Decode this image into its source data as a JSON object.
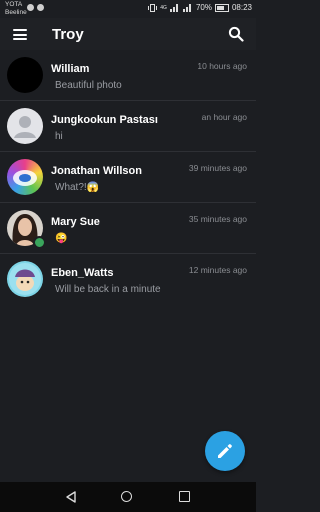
{
  "status_bar": {
    "carrier_line1": "YOTA",
    "carrier_line2": "Beeline",
    "network": "4G",
    "battery": "70%",
    "battery_level": 0.7,
    "time": "08:23"
  },
  "app_bar": {
    "title": "Troy",
    "menu_icon": "menu-icon",
    "search_icon": "search-icon"
  },
  "chats": [
    {
      "name": "William",
      "time": "10 hours ago",
      "preview": "Beautiful photo",
      "avatar": "black-avatar"
    },
    {
      "name": "Jungkookun Pastası",
      "time": "an hour ago",
      "preview": "hi",
      "avatar": "default-person-avatar"
    },
    {
      "name": "Jonathan Willson",
      "time": "39 minutes ago",
      "preview": "What?!😱",
      "avatar": "colorful-avatar"
    },
    {
      "name": "Mary Sue",
      "time": "35 minutes ago",
      "preview": "😜",
      "avatar": "woman-photo-avatar",
      "online": true
    },
    {
      "name": "Eben_Watts",
      "time": "12 minutes ago",
      "preview": "Will be back in a minute",
      "avatar": "cartoon-avatar"
    }
  ],
  "fab": {
    "icon": "pencil-icon"
  },
  "colors": {
    "background": "#1c1e22",
    "fab": "#2ba1e3",
    "online": "#3aa55c"
  }
}
